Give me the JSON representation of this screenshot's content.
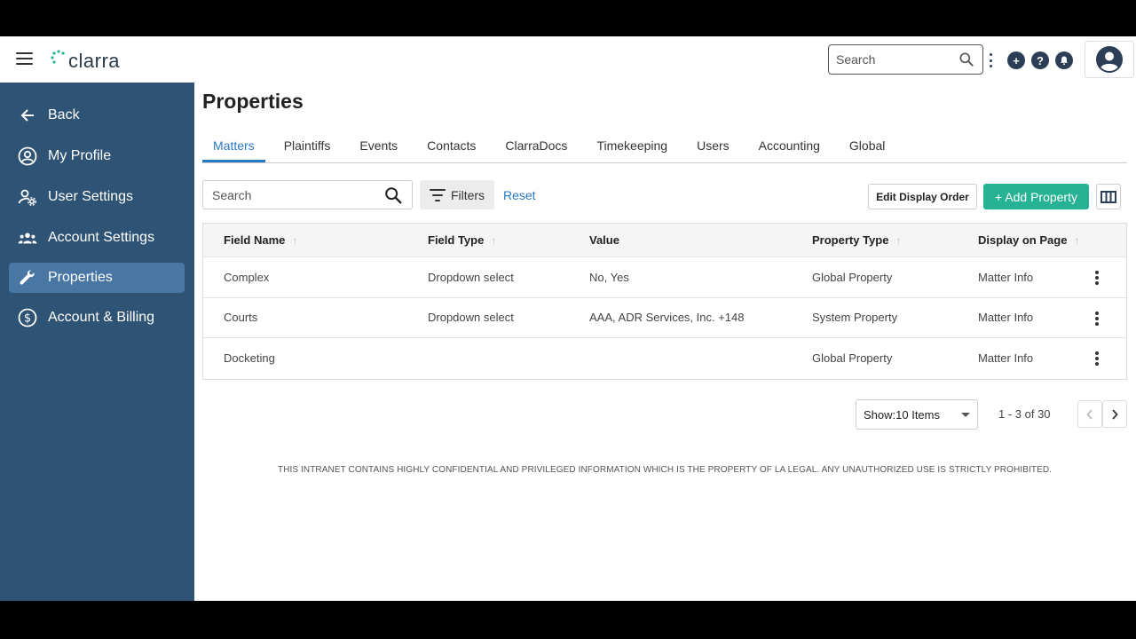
{
  "app": {
    "logo_text": "clarra"
  },
  "topbar": {
    "search_placeholder": "Search",
    "icons": [
      "menu-icon",
      "search-icon",
      "more-vertical-icon",
      "add-circle-icon",
      "help-icon",
      "notification-bell-icon",
      "user-avatar-icon"
    ]
  },
  "sidebar": {
    "items": [
      {
        "label": "Back",
        "icon": "arrow-left-icon",
        "active": false
      },
      {
        "label": "My Profile",
        "icon": "person-circle-icon",
        "active": false
      },
      {
        "label": "User Settings",
        "icon": "user-gear-icon",
        "active": false
      },
      {
        "label": "Account Settings",
        "icon": "group-icon",
        "active": false
      },
      {
        "label": "Properties",
        "icon": "wrench-icon",
        "active": true
      },
      {
        "label": "Account & Billing",
        "icon": "dollar-circle-icon",
        "active": false
      }
    ]
  },
  "page": {
    "title": "Properties",
    "tabs": [
      {
        "label": "Matters",
        "active": true
      },
      {
        "label": "Plaintiffs"
      },
      {
        "label": "Events"
      },
      {
        "label": "Contacts"
      },
      {
        "label": "ClarraDocs"
      },
      {
        "label": "Timekeeping"
      },
      {
        "label": "Users"
      },
      {
        "label": "Accounting"
      },
      {
        "label": "Global"
      }
    ],
    "search_placeholder": "Search",
    "filters_label": "Filters",
    "reset_label": "Reset",
    "edit_display_order_label": "Edit Display Order",
    "add_property_label": "+ Add Property"
  },
  "table": {
    "headers": [
      "Field Name",
      "Field Type",
      "Value",
      "Property Type",
      "Display on Page"
    ],
    "rows": [
      [
        "Complex",
        "Dropdown select",
        "No, Yes",
        "Global Property",
        "Matter Info"
      ],
      [
        "Courts",
        "Dropdown select",
        "AAA, ADR Services, Inc. +148",
        "System Property",
        "Matter Info"
      ],
      [
        "Docketing",
        "",
        "",
        "Global Property",
        "Matter Info"
      ]
    ]
  },
  "pagination": {
    "show_label": "Show:10 Items",
    "range_text": "1 - 3 of 30"
  },
  "footer": {
    "disclaimer": "THIS INTRANET CONTAINS HIGHLY CONFIDENTIAL AND PRIVILEGED INFORMATION WHICH IS THE PROPERTY OF LA LEGAL. ANY UNAUTHORIZED USE IS STRICTLY PROHIBITED."
  },
  "colors": {
    "sidebar_bg": "#2f5375",
    "sidebar_active": "#4877a4",
    "accent_blue": "#2a78c2",
    "add_button_green": "#26b393",
    "icon_navy": "#2b3e55"
  }
}
